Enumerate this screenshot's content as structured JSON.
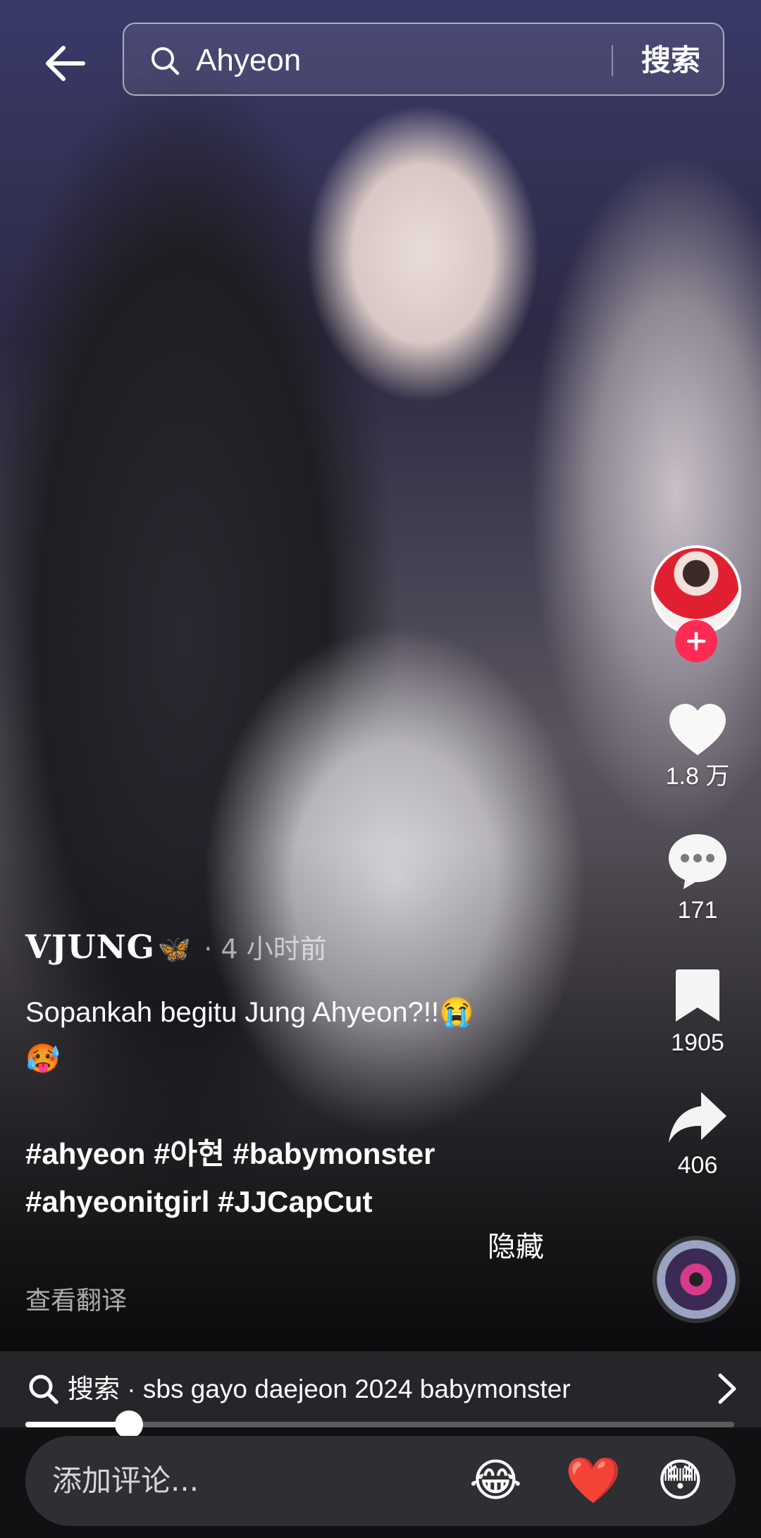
{
  "top_bar": {
    "search_query": "Ahyeon",
    "search_button_label": "搜索"
  },
  "post": {
    "author": "VJUNG",
    "author_emoji": "🦋",
    "time": "· 4 小时前",
    "caption_line1": "Sopankah begitu Jung Ahyeon?!!😭",
    "caption_line2": "🥵",
    "hashtags_line1": "#ahyeon #아현 #babymonster",
    "hashtags_line2": "#ahyeonitgirl #JJCapCut",
    "hide_label": "隐藏",
    "translate_label": "查看翻译"
  },
  "actions": {
    "likes": "1.8 万",
    "comments": "171",
    "saves": "1905",
    "shares": "406"
  },
  "suggestion": {
    "text": "搜索 · sbs gayo daejeon 2024 babymonster"
  },
  "playback": {
    "progress_fraction": 0.146
  },
  "comment_bar": {
    "placeholder": "添加评论...",
    "emojis": [
      "😂",
      "❤️",
      "😳"
    ]
  },
  "icons": {
    "back": "arrow-left-icon",
    "search": "search-icon",
    "like": "heart-icon",
    "comment": "comment-bubble-icon",
    "save": "bookmark-icon",
    "share": "share-arrow-icon",
    "follow": "plus-icon",
    "chevron": "chevron-right-icon"
  },
  "colors": {
    "accent": "#fe2c55",
    "bar_bg": "#26262a"
  }
}
